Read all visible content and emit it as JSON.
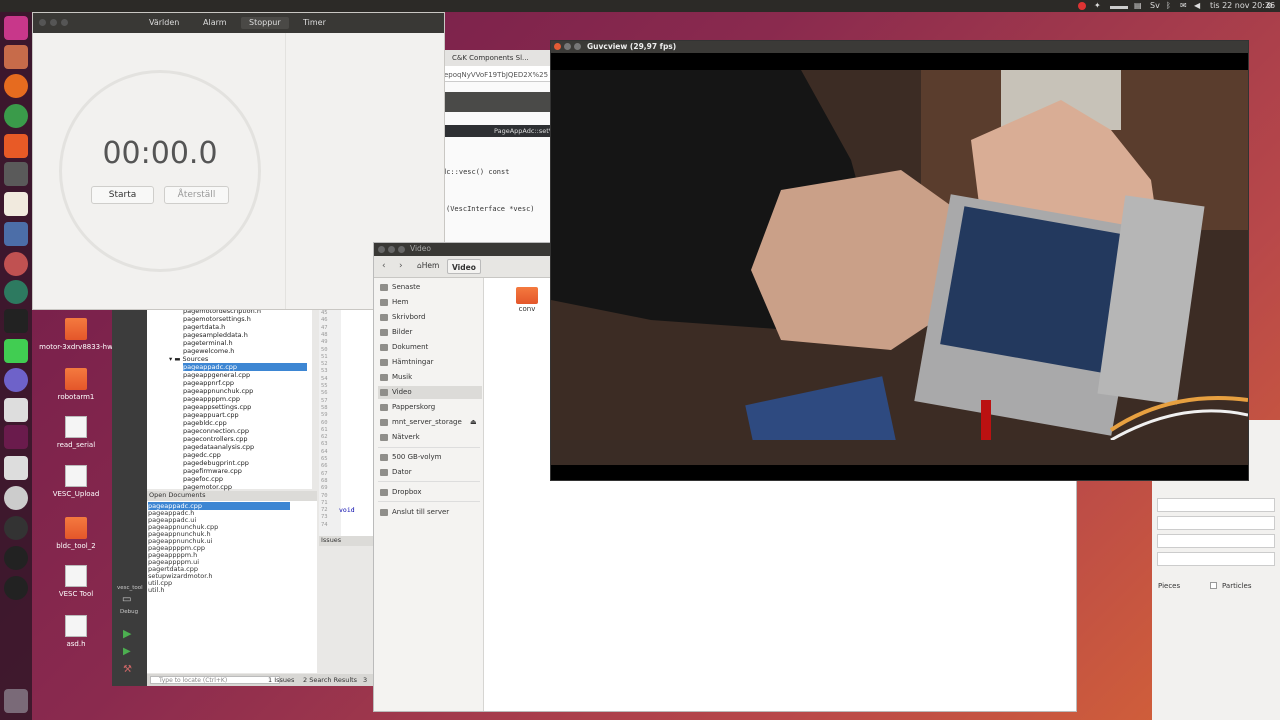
{
  "topbar": {
    "clock": "tis 22 nov 20:26"
  },
  "desktop_icons": [
    {
      "label": "motor-3xdrv8833-hw",
      "kind": "folder"
    },
    {
      "label": "robotarm1",
      "kind": "folder"
    },
    {
      "label": "read_serial",
      "kind": "file"
    },
    {
      "label": "VESC_Upload",
      "kind": "file"
    },
    {
      "label": "bldc_tool_2",
      "kind": "folder"
    },
    {
      "label": "VESC Tool",
      "kind": "file"
    },
    {
      "label": "asd.h",
      "kind": "file"
    }
  ],
  "clock": {
    "tabs": [
      "Världen",
      "Alarm",
      "Stoppur",
      "Timer"
    ],
    "active_tab": "Stoppur",
    "time": "00:00.0",
    "start": "Starta",
    "reset": "Återställ"
  },
  "browser": {
    "tab": "C&K Components Sl...",
    "url": "epoqNyVVoF19TbJQED2X%25",
    "editor_tab": "PageAppAdc::setV"
  },
  "editor": {
    "code1": "dc::vesc() const",
    "code2": "(VescInterface *vesc)",
    "code3": "void",
    "line_numbers": [
      "45",
      "46",
      "47",
      "48",
      "49",
      "50",
      "51",
      "52",
      "53",
      "54",
      "55",
      "56",
      "57",
      "58",
      "59",
      "60",
      "61",
      "62",
      "63",
      "64",
      "65",
      "66",
      "67",
      "68",
      "69",
      "70",
      "71",
      "72",
      "73",
      "74"
    ]
  },
  "qt": {
    "project_items": [
      "pagemotordescription.h",
      "pagemotorsettings.h",
      "pagertdata.h",
      "pagesampleddata.h",
      "pageterminal.h",
      "pagewelcome.h"
    ],
    "sources_label": "Sources",
    "source_items": [
      "pageappadc.cpp",
      "pageappgeneral.cpp",
      "pageappnrf.cpp",
      "pageappnunchuk.cpp",
      "pageappppm.cpp",
      "pageappsettings.cpp",
      "pageappuart.cpp",
      "pagebldc.cpp",
      "pageconnection.cpp",
      "pagecontrollers.cpp",
      "pagedataanalysis.cpp",
      "pagedc.cpp",
      "pagedebugprint.cpp",
      "pagefirmware.cpp",
      "pagefoc.cpp",
      "pagemotor.cpp"
    ],
    "open_docs_title": "Open Documents",
    "open_docs": [
      "pageappadc.cpp",
      "pageappadc.h",
      "pageappadc.ui",
      "pageappnunchuk.cpp",
      "pageappnunchuk.h",
      "pageappnunchuk.ui",
      "pageappppm.cpp",
      "pageappppm.h",
      "pageappppm.ui",
      "pagertdata.cpp",
      "setupwizardmotor.h",
      "util.cpp",
      "util.h"
    ],
    "issues": "Issues",
    "kit_label": "vesc_tool",
    "mode": "Debug",
    "locate": "Type to locate (Ctrl+K)",
    "status_issues": "1 Issues",
    "status_search": "2 Search Results",
    "status_num": "3"
  },
  "files": {
    "title": "Video",
    "path_home": "Hem",
    "path_current": "Video",
    "sidebar": [
      "Senaste",
      "Hem",
      "Skrivbord",
      "Bilder",
      "Dokument",
      "Hämtningar",
      "Musik",
      "Video",
      "Papperskorg",
      "mnt_server_storage",
      "Nätverk",
      "500 GB-volym",
      "Dator",
      "Dropbox",
      "Anslut till server"
    ],
    "active": "Video",
    "folder": "conv"
  },
  "guv": {
    "title": "Guvcview  (29,97 fps)"
  },
  "right_panel": {
    "pieces": "Pieces",
    "particles": "Particles"
  }
}
